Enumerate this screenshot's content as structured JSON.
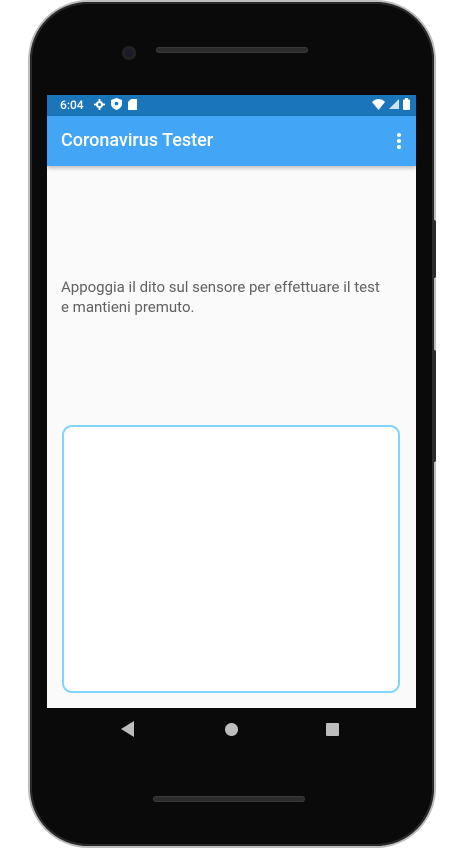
{
  "status_bar": {
    "time": "6:04",
    "icons_left": [
      "settings-icon",
      "shield-icon",
      "sd-card-icon"
    ],
    "icons_right": [
      "wifi-icon",
      "signal-icon",
      "battery-icon"
    ]
  },
  "app_bar": {
    "title": "Coronavirus Tester",
    "overflow_icon": "more-vert-icon",
    "color": "#42a5f5",
    "status_color": "#1b75bb"
  },
  "main": {
    "instruction": "Appoggia il dito sul sensore per effettuare il test e mantieni premuto.",
    "sensor_border_color": "#81d4fa"
  },
  "nav_bar": {
    "buttons": [
      "back-icon",
      "home-icon",
      "recents-icon"
    ]
  }
}
